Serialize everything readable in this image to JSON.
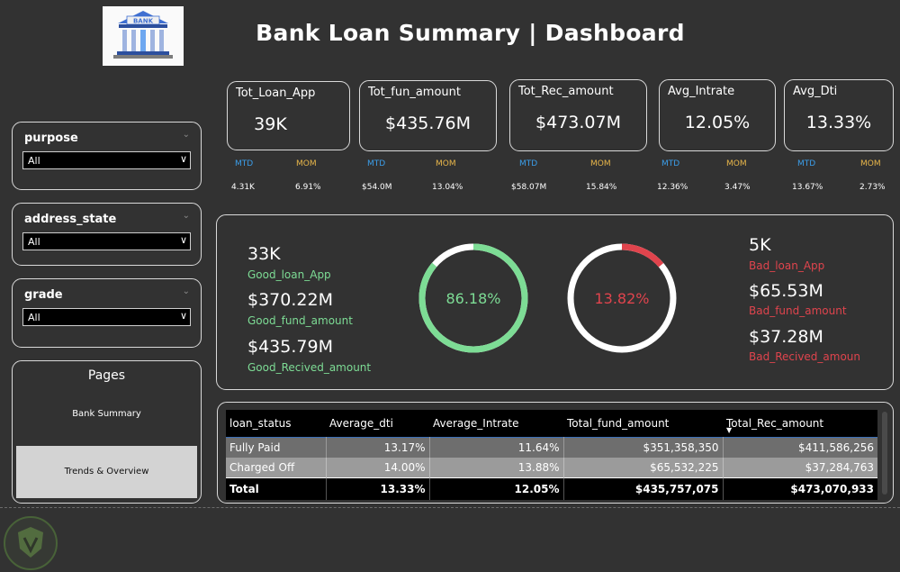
{
  "header": {
    "title": "Bank Loan Summary | Dashboard",
    "logo_text": "BANK"
  },
  "kpis": [
    {
      "label": "Tot_Loan_App",
      "value": "39K",
      "mtd_label": "MTD",
      "mom_label": "MOM",
      "mtd": "4.31K",
      "mom": "6.91%"
    },
    {
      "label": "Tot_fun_amount",
      "value": "$435.76M",
      "mtd_label": "MTD",
      "mom_label": "MOM",
      "mtd": "$54.0M",
      "mom": "13.04%"
    },
    {
      "label": "Tot_Rec_amount",
      "value": "$473.07M",
      "mtd_label": "MTD",
      "mom_label": "MOM",
      "mtd": "$58.07M",
      "mom": "15.84%"
    },
    {
      "label": "Avg_Intrate",
      "value": "12.05%",
      "mtd_label": "MTD",
      "mom_label": "MOM",
      "mtd": "12.36%",
      "mom": "3.47%"
    },
    {
      "label": "Avg_Dti",
      "value": "13.33%",
      "mtd_label": "MTD",
      "mom_label": "MOM",
      "mtd": "13.67%",
      "mom": "2.73%"
    }
  ],
  "slicers": [
    {
      "label": "purpose",
      "value": "All"
    },
    {
      "label": "address_state",
      "value": "All"
    },
    {
      "label": "grade",
      "value": "All"
    }
  ],
  "pages": {
    "title": "Pages",
    "items": [
      "Bank Summary",
      "Trends & Overview"
    ]
  },
  "good": {
    "apps": "33K",
    "apps_label": "Good_loan_App",
    "fund": "$370.22M",
    "fund_label": "Good_fund_amount",
    "rec": "$435.79M",
    "rec_label": "Good_Recived_amount",
    "pct": 86.18,
    "pct_label": "86.18%"
  },
  "bad": {
    "apps": "5K",
    "apps_label": "Bad_loan_App",
    "fund": "$65.53M",
    "fund_label": "Bad_fund_amount",
    "rec": "$37.28M",
    "rec_label": "Bad_Recived_amoun",
    "pct": 13.82,
    "pct_label": "13.82%"
  },
  "table": {
    "headers": [
      "loan_status",
      "Average_dti",
      "Average_Intrate",
      "Total_fund_amount",
      "Total_Rec_amount"
    ],
    "rows": [
      [
        "Fully Paid",
        "13.17%",
        "11.64%",
        "$351,358,350",
        "$411,586,256"
      ],
      [
        "Charged Off",
        "14.00%",
        "13.88%",
        "$65,532,225",
        "$37,284,763"
      ]
    ],
    "total": [
      "Total",
      "13.33%",
      "12.05%",
      "$435,757,075",
      "$473,070,933"
    ]
  },
  "colors": {
    "good": "#7ddc95",
    "bad": "#e0444d",
    "mtd": "#3b9eea",
    "mom": "#e8b64a",
    "background": "#323232"
  }
}
